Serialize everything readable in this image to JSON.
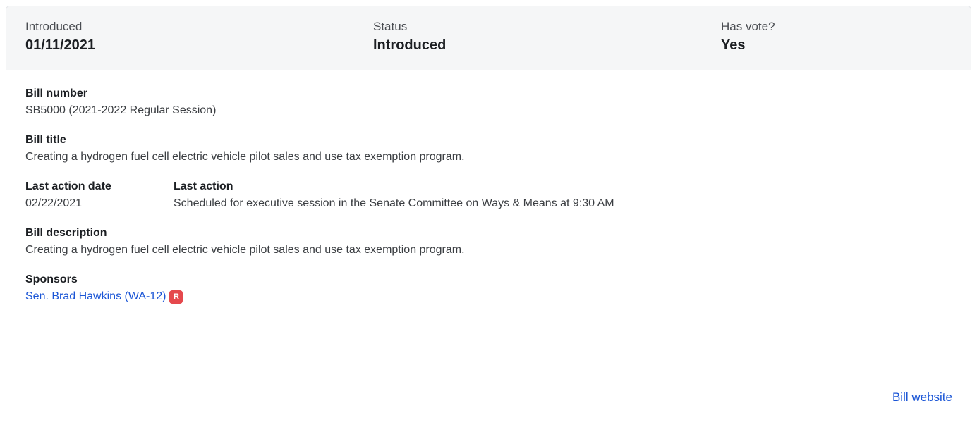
{
  "summary": {
    "introduced_label": "Introduced",
    "introduced_value": "01/11/2021",
    "status_label": "Status",
    "status_value": "Introduced",
    "has_vote_label": "Has vote?",
    "has_vote_value": "Yes"
  },
  "details": {
    "bill_number_label": "Bill number",
    "bill_number_value": "SB5000 (2021-2022 Regular Session)",
    "bill_title_label": "Bill title",
    "bill_title_value": "Creating a hydrogen fuel cell electric vehicle pilot sales and use tax exemption program.",
    "last_action_date_label": "Last action date",
    "last_action_date_value": "02/22/2021",
    "last_action_label": "Last action",
    "last_action_value": "Scheduled for executive session in the Senate Committee on Ways & Means at 9:30 AM",
    "bill_description_label": "Bill description",
    "bill_description_value": "Creating a hydrogen fuel cell electric vehicle pilot sales and use tax exemption program.",
    "sponsors_label": "Sponsors",
    "sponsors": [
      {
        "name": "Sen. Brad Hawkins (WA-12)",
        "party": "R",
        "party_color": "#e5484d"
      }
    ]
  },
  "footer": {
    "website_link": "Bill website"
  },
  "colors": {
    "link": "#1a55d6",
    "summary_bg": "#f5f6f7",
    "border": "#e2e4e7"
  }
}
